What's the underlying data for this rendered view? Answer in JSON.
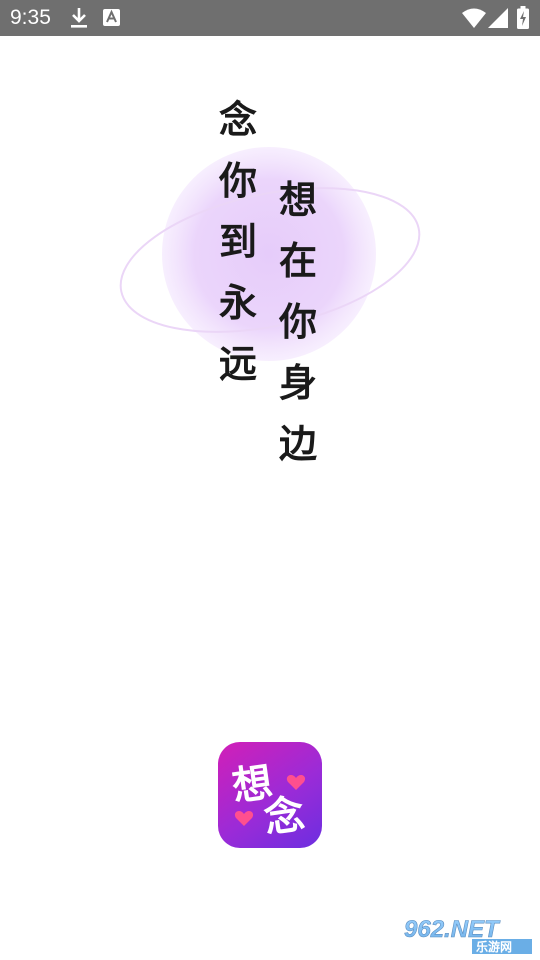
{
  "status_bar": {
    "time": "9:35",
    "icons": [
      "download-icon",
      "font-a-icon",
      "wifi-icon",
      "signal-icon",
      "battery-charging-icon"
    ],
    "background_color": "#6f6f6f"
  },
  "splash": {
    "slogan_left": [
      "念",
      "你",
      "到",
      "永",
      "远"
    ],
    "slogan_right": [
      "想",
      "在",
      "你",
      "身",
      "边"
    ],
    "accent_color": "#e6ccfa"
  },
  "app_icon": {
    "glyph_top": "想",
    "glyph_bottom": "念",
    "gradient": [
      "#d21fb7",
      "#6c2ee0"
    ],
    "heart_color": "#ff4f8f"
  },
  "watermark": {
    "brand": "962.NET",
    "subtitle": "乐游网"
  }
}
